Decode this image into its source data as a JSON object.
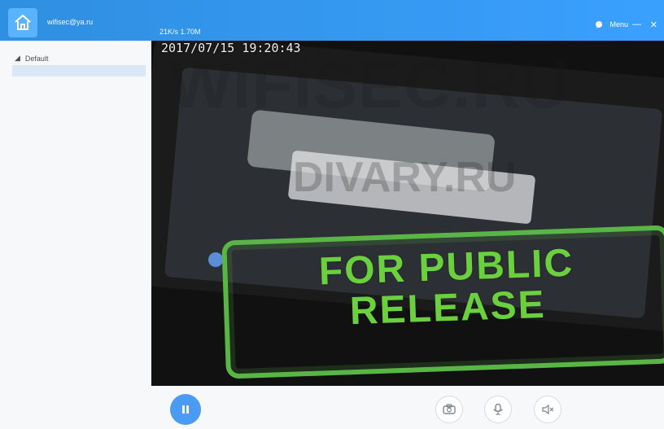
{
  "titlebar": {
    "account": "wifisec@ya.ru",
    "speed": "21K/s 1.70M",
    "menu_label": "Menu",
    "minimize_symbol": "—",
    "close_symbol": "✕"
  },
  "sidebar": {
    "group_label": "Default"
  },
  "video": {
    "timestamp": "2017/07/15 19:20:43",
    "watermark_primary": "WiFiSEC.RU",
    "watermark_secondary": "DIVARY.RU",
    "stamp_line1": "FOR PUBLIC",
    "stamp_line2": "RELEASE"
  },
  "controls": {
    "pause_icon": "pause-icon",
    "camera_icon": "camera-icon",
    "mic_icon": "microphone-icon",
    "mute_icon": "speaker-mute-icon"
  },
  "colors": {
    "accent": "#3aa0ff",
    "stamp": "#59b546"
  }
}
